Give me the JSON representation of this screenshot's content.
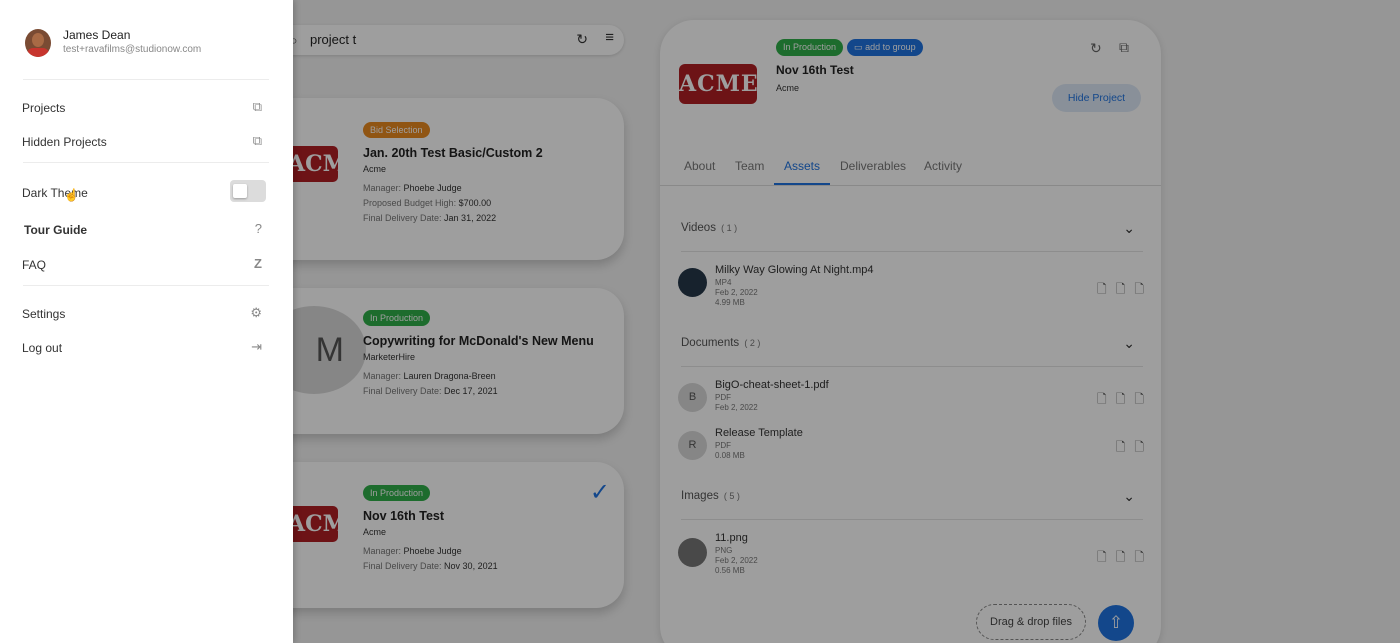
{
  "drawer": {
    "user_name": "James Dean",
    "user_email": "test+ravafilms@studionow.com",
    "menu": {
      "projects": "Projects",
      "hidden_projects": "Hidden Projects",
      "dark_theme": "Dark Theme",
      "tour_guide": "Tour Guide",
      "faq": "FAQ",
      "settings": "Settings",
      "logout": "Log out"
    },
    "dark_theme_on": false
  },
  "search": {
    "value": "project t"
  },
  "cards": [
    {
      "badge": "Bid Selection",
      "title": "Jan. 20th Test Basic/Custom 2",
      "client": "Acme",
      "logo": "ACME",
      "manager_label": "Manager:",
      "manager": "Phoebe Judge",
      "budget_label": "Proposed Budget High:",
      "budget": "$700.00",
      "delivery_label": "Final Delivery Date:",
      "delivery": "Jan 31, 2022"
    },
    {
      "badge": "In Production",
      "title": "Copywriting for McDonald's New Menu",
      "client": "MarketerHire",
      "logo": "M",
      "manager_label": "Manager:",
      "manager": "Lauren Dragona-Breen",
      "delivery_label": "Final Delivery Date:",
      "delivery": "Dec 17, 2021"
    },
    {
      "badge": "In Production",
      "title": "Nov 16th Test",
      "client": "Acme",
      "logo": "ACME",
      "manager_label": "Manager:",
      "manager": "Phoebe Judge",
      "delivery_label": "Final Delivery Date:",
      "delivery": "Nov 30, 2021"
    }
  ],
  "detail": {
    "logo": "ACME",
    "status_badge": "In Production",
    "group_badge": "add to group",
    "title": "Nov 16th Test",
    "client": "Acme",
    "hide_button": "Hide Project",
    "tabs": [
      "About",
      "Team",
      "Assets",
      "Deliverables",
      "Activity"
    ],
    "active_tab": "Assets",
    "sections": {
      "videos": {
        "label": "Videos",
        "count": "( 1 )"
      },
      "documents": {
        "label": "Documents",
        "count": "( 2 )"
      },
      "images": {
        "label": "Images",
        "count": "( 5 )"
      }
    },
    "assets": {
      "video1": {
        "name": "Milky Way Glowing At Night.mp4",
        "type": "MP4",
        "date": "Feb 2, 2022",
        "size": "4.99 MB"
      },
      "doc1": {
        "initial": "B",
        "name": "BigO-cheat-sheet-1.pdf",
        "type": "PDF",
        "date": "Feb 2, 2022"
      },
      "doc2": {
        "initial": "R",
        "name": "Release Template",
        "type": "PDF",
        "size": "0.08 MB"
      },
      "img1": {
        "name": "11.png",
        "type": "PNG",
        "date": "Feb 2, 2022",
        "size": "0.56 MB"
      }
    },
    "drag_drop": "Drag & drop files"
  },
  "colors": {
    "accent": "#1f73e0",
    "in_production": "#2fae49",
    "bid_selection": "#e8891f",
    "acme_red": "#b11f24"
  }
}
